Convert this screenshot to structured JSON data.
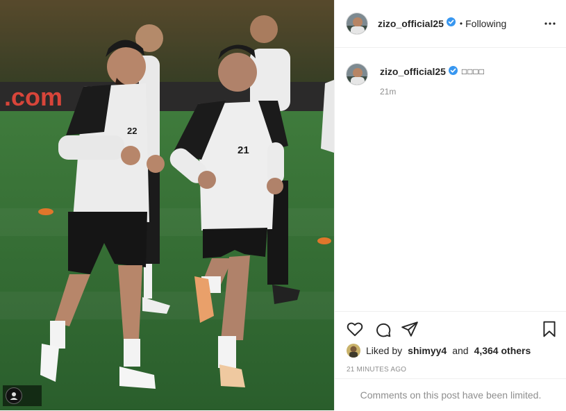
{
  "post": {
    "username": "zizo_official25",
    "follow_status": "Following",
    "separator": "•",
    "caption_text": "□□□□",
    "caption_time": "21m",
    "liked_by_prefix": "Liked by",
    "liked_by_user": "shimyy4",
    "liked_by_joiner": "and",
    "liked_by_others": "4,364 others",
    "posted_ago": "21 MINUTES AGO",
    "comments_notice": "Comments on this post have been limited."
  },
  "photo": {
    "jersey_numbers": [
      "22",
      "21"
    ],
    "ad_board_text": ".com"
  },
  "icons": {
    "verified": "verified-badge-icon",
    "more": "more-options-icon",
    "like": "heart-icon",
    "comment": "comment-bubble-icon",
    "share": "paper-plane-icon",
    "save": "bookmark-icon"
  },
  "colors": {
    "verified_blue": "#3897f0",
    "text": "#262626",
    "muted": "#8e8e8e",
    "divider": "#efefef",
    "pitch_green": "#2f6d34"
  }
}
